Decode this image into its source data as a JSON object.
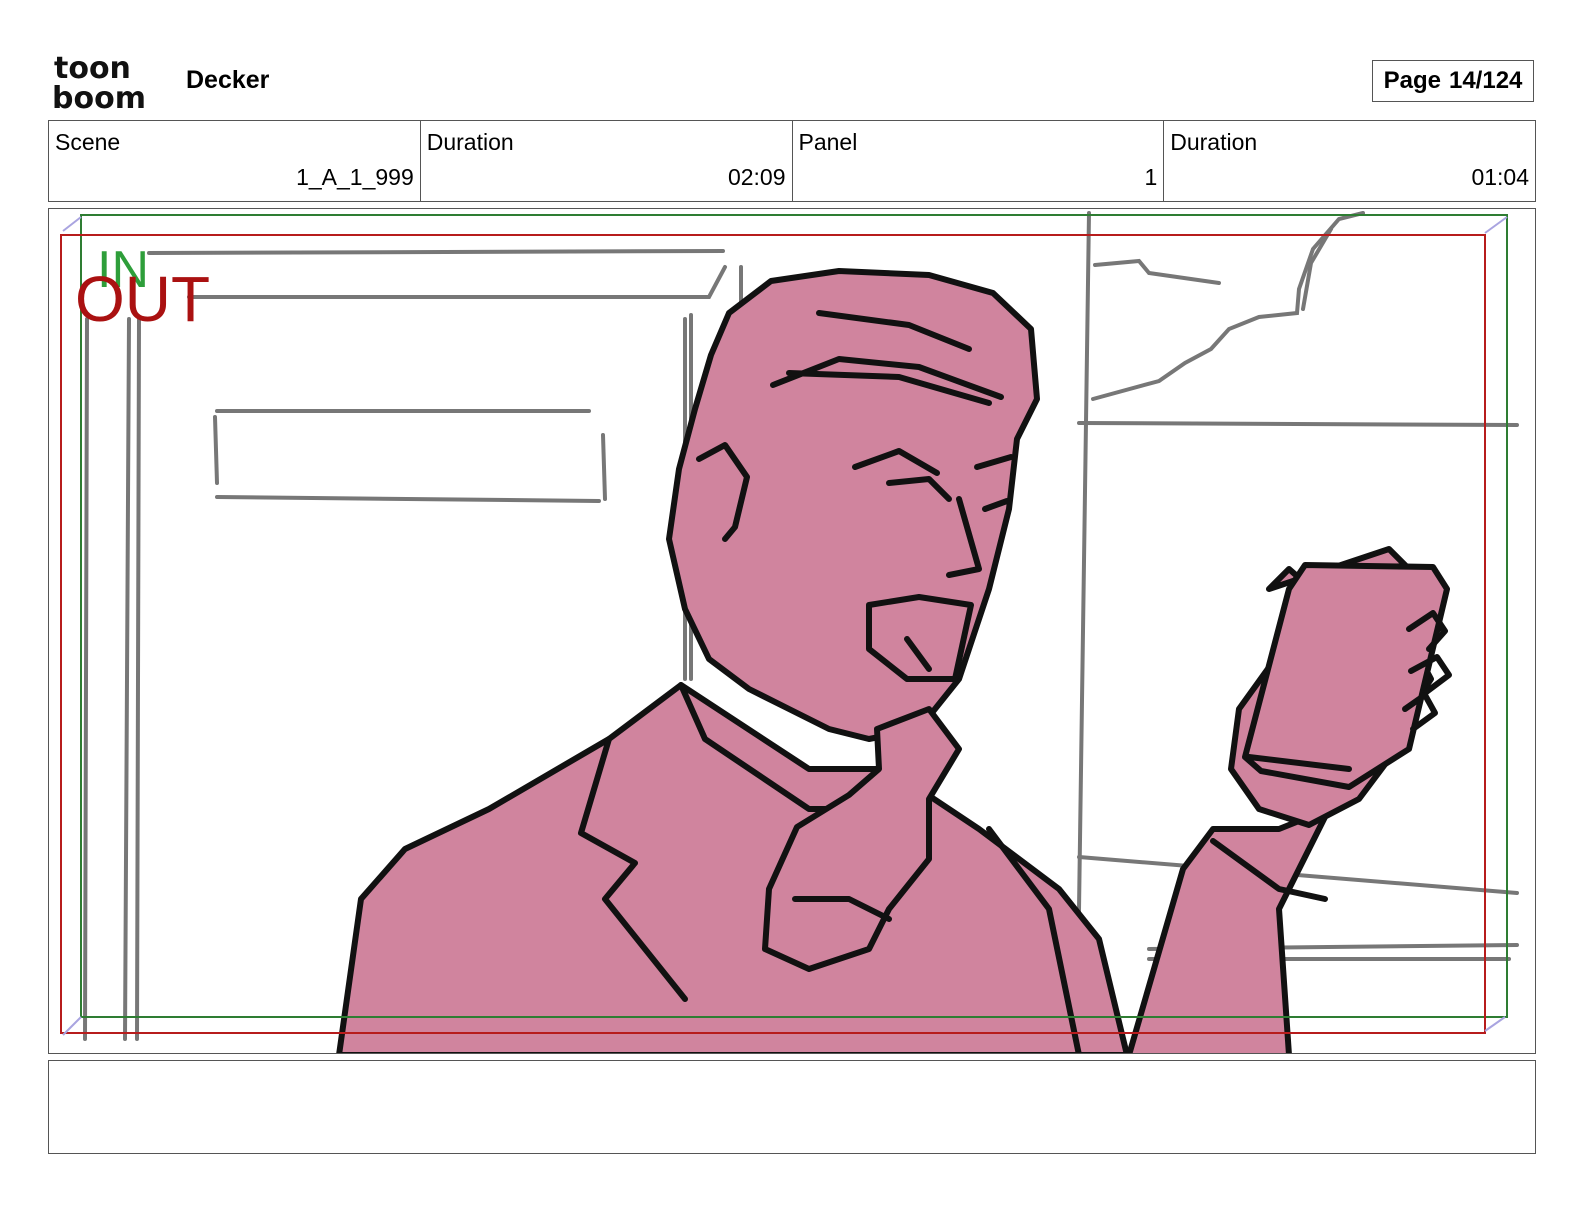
{
  "header": {
    "logo_line1": "toon",
    "logo_line2": "boom",
    "project_name": "Decker",
    "page_label": "Page",
    "page_value": "14/124"
  },
  "info": {
    "scene_label": "Scene",
    "scene_value": "1_A_1_999",
    "scene_duration_label": "Duration",
    "scene_duration_value": "02:09",
    "panel_label": "Panel",
    "panel_value": "1",
    "panel_duration_label": "Duration",
    "panel_duration_value": "01:04"
  },
  "panel": {
    "in_marker": "IN",
    "out_marker": "OUT",
    "colors": {
      "in_frame": "#2e7d32",
      "out_frame": "#b71c1c",
      "character_fill": "#d0849e",
      "pencil": "#777777",
      "ink": "#111111"
    }
  },
  "caption": {
    "text": ""
  }
}
